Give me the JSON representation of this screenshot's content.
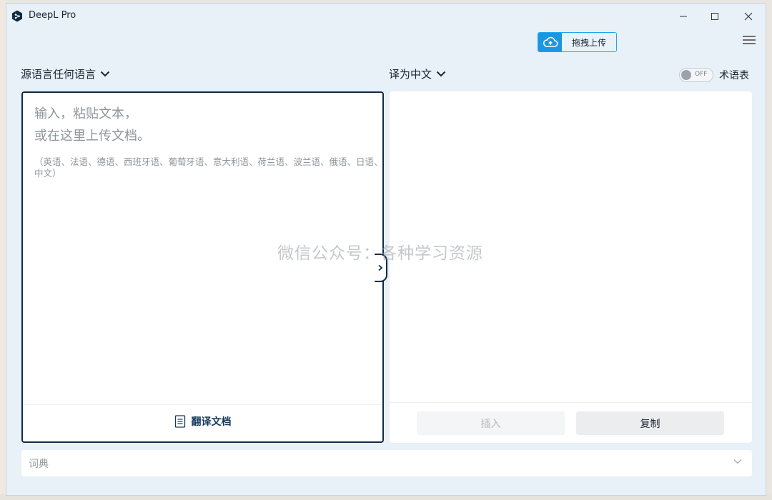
{
  "window": {
    "title": "DeepL Pro"
  },
  "toolbar": {
    "upload_label": "拖拽上传"
  },
  "source": {
    "language_label": "源语言任何语言",
    "placeholder_line1": "输入，粘贴文本，",
    "placeholder_line2": "或在这里上传文档。",
    "supported_languages": "（英语、法语、德语、西班牙语、葡萄牙语、意大利语、荷兰语、波兰语、俄语、日语、中文）",
    "translate_document_label": "翻译文档"
  },
  "target": {
    "language_label": "译为中文",
    "insert_label": "插入",
    "copy_label": "复制"
  },
  "glossary": {
    "toggle_state": "OFF",
    "label": "术语表"
  },
  "watermark": "微信公众号：各种学习资源",
  "dictionary": {
    "label": "词典"
  },
  "colors": {
    "accent": "#1a97e0",
    "border_dark": "#0f2b46",
    "background": "#e8f0f8"
  }
}
